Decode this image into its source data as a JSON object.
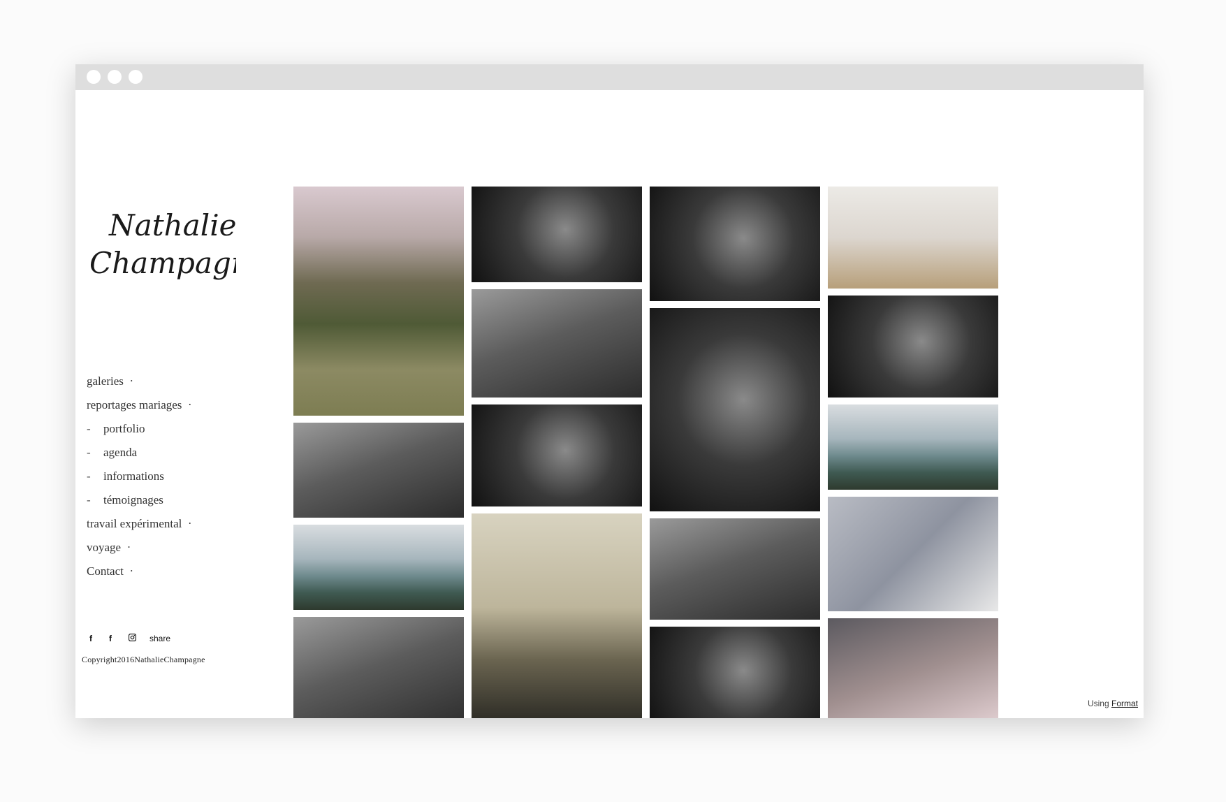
{
  "site": {
    "logo_text_line1": "Nathalie",
    "logo_text_line2": "Champagne"
  },
  "nav": [
    {
      "label": "galeries",
      "sub": false,
      "bullet": "•"
    },
    {
      "label": "reportages mariages",
      "sub": false,
      "bullet": "•"
    },
    {
      "label": "portfolio",
      "sub": true,
      "dash": "-"
    },
    {
      "label": "agenda",
      "sub": true,
      "dash": "-"
    },
    {
      "label": "informations",
      "sub": true,
      "dash": "-"
    },
    {
      "label": "témoignages",
      "sub": true,
      "dash": "-"
    },
    {
      "label": "travail expérimental",
      "sub": false,
      "bullet": "•"
    },
    {
      "label": "voyage",
      "sub": false,
      "bullet": "•"
    },
    {
      "label": "Contact",
      "sub": false,
      "bullet": "•"
    }
  ],
  "social": {
    "icons": [
      "facebook-icon",
      "facebook-icon",
      "instagram-icon"
    ],
    "share_label": "share"
  },
  "footer": {
    "copyright": "Copyright2016NathalieChampagne",
    "using_label": "Using",
    "format_link": "Format"
  },
  "gallery": {
    "columns": [
      {
        "tiles": [
          {
            "name": "photo-couple-tree",
            "tone": "color-green"
          },
          {
            "name": "photo-vintage-car",
            "tone": "bw"
          },
          {
            "name": "photo-seaside-landscape",
            "tone": "color-teal"
          },
          {
            "name": "photo-kiss-closeup",
            "tone": "bw"
          }
        ]
      },
      {
        "tiles": [
          {
            "name": "photo-couple-kiss",
            "tone": "bw-dark"
          },
          {
            "name": "photo-woman-camera",
            "tone": "bw"
          },
          {
            "name": "photo-dance-crowd",
            "tone": "bw-dark"
          },
          {
            "name": "photo-bride-sculpture",
            "tone": "color-warm"
          }
        ]
      },
      {
        "tiles": [
          {
            "name": "photo-elderly-kiss",
            "tone": "bw-dark"
          },
          {
            "name": "photo-woman-portrait",
            "tone": "bw-dark"
          },
          {
            "name": "photo-children-party",
            "tone": "bw"
          },
          {
            "name": "photo-night-party",
            "tone": "bw-dark"
          }
        ]
      },
      {
        "tiles": [
          {
            "name": "photo-couple-veil",
            "tone": "color-light"
          },
          {
            "name": "photo-couple-doorway",
            "tone": "bw-dark"
          },
          {
            "name": "photo-dune-beach",
            "tone": "color-teal"
          },
          {
            "name": "photo-bride-tiles",
            "tone": "bw-light"
          },
          {
            "name": "photo-child-hat",
            "tone": "color-pink"
          }
        ]
      }
    ]
  },
  "colors": {
    "window_bg": "#ffffff",
    "titlebar": "#dedede",
    "text": "#333333"
  }
}
